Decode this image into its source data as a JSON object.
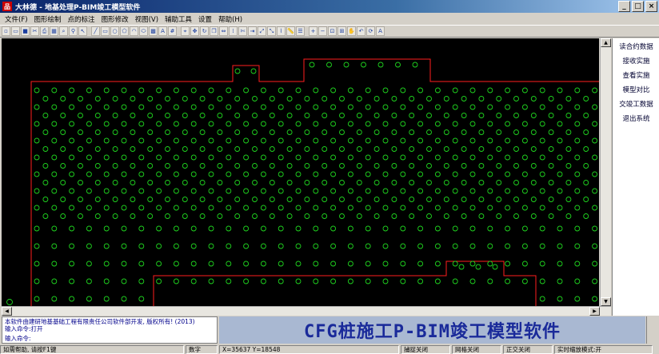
{
  "window": {
    "title": "大林德  -  地基处理P-BIM竣工模型软件",
    "icon_label": "品",
    "buttons": {
      "minimize": "_",
      "maximize": "□",
      "close": "×"
    }
  },
  "menu": [
    "文件(F)",
    "图形绘制",
    "点的标注",
    "图形修改",
    "视图(V)",
    "辅助工具",
    "设置",
    "帮助(H)"
  ],
  "toolbar_icons": [
    "new-icon",
    "open-icon",
    "save-icon",
    "cut-icon",
    "print-icon",
    "preview-icon",
    "find-icon",
    "pin-icon",
    "cursor-icon",
    "line-icon",
    "rect-icon",
    "circle-icon",
    "polygon-icon",
    "arc-icon",
    "ellipse-icon",
    "hatch-icon",
    "text-icon",
    "grid-icon",
    "snap-icon",
    "move-icon",
    "rotate-icon",
    "copy-icon",
    "mirror-icon",
    "array-icon",
    "trim-icon",
    "extend-icon",
    "stretch-icon",
    "scale-icon",
    "break-icon",
    "measure-icon",
    "layer-icon",
    "zoom-in-icon",
    "zoom-out-icon",
    "zoom-window-icon",
    "zoom-all-icon",
    "pan-icon",
    "zoom-prev-icon",
    "regen-icon",
    "font-icon"
  ],
  "sidebar": {
    "buttons": [
      "读合约数据",
      "接收实施",
      "查看实施",
      "模型对比",
      "交竣工数据",
      "退出系统"
    ]
  },
  "command": {
    "lines": [
      "本软件由建研地基基础工程有限责任公司软件部开发, 版权所有! (2013)",
      "输入命令:打开"
    ],
    "prompt": "输入命令:"
  },
  "banner": {
    "text": "CFG桩施工P-BIM竣工模型软件"
  },
  "status": {
    "help": "如需帮助, 请按F1键",
    "mode": "数字",
    "coords": "X=35637 Y=18548",
    "items": [
      "捕捉关闭",
      "网格关闭",
      "正交关闭",
      "实时缩放模式:开"
    ]
  },
  "colors": {
    "canvas_bg": "#000000",
    "pile": "#1fd41f",
    "boundary": "#ff1e1e",
    "banner_text": "#1a2a9a"
  }
}
